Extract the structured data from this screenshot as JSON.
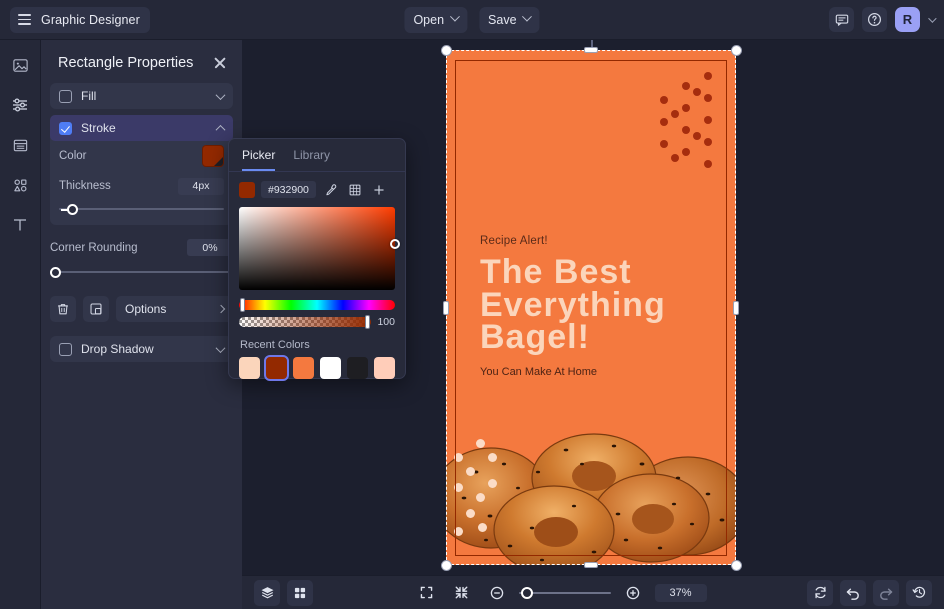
{
  "topbar": {
    "menu_label": "Graphic Designer",
    "menu_icon": "hamburger-icon",
    "open_label": "Open",
    "save_label": "Save",
    "comment_icon": "comment-icon",
    "help_icon": "help-circle-icon",
    "avatar_initial": "R"
  },
  "rail": {
    "items": [
      {
        "name": "image-icon"
      },
      {
        "name": "adjustments-icon"
      },
      {
        "name": "layout-icon"
      },
      {
        "name": "shapes-icon"
      },
      {
        "name": "text-icon"
      }
    ]
  },
  "panel": {
    "title": "Rectangle Properties",
    "close_label": "×",
    "fill": {
      "label": "Fill",
      "checked": false
    },
    "stroke": {
      "label": "Stroke",
      "checked": true
    },
    "color": {
      "label": "Color",
      "value": "#932900"
    },
    "thickness": {
      "label": "Thickness",
      "value": "4px",
      "percent": 5
    },
    "corner_rounding": {
      "label": "Corner Rounding",
      "value": "0%",
      "percent": 0
    },
    "delete_icon": "trash-icon",
    "duplicate_icon": "duplicate-icon",
    "options_label": "Options",
    "drop_shadow": {
      "label": "Drop Shadow",
      "checked": false
    }
  },
  "picker": {
    "tabs": [
      {
        "label": "Picker",
        "active": true
      },
      {
        "label": "Library",
        "active": false
      }
    ],
    "hex": "#932900",
    "eyedropper_icon": "eyedropper-icon",
    "palette_icon": "grid-palette-icon",
    "add_icon": "plus-icon",
    "alpha_value": "100",
    "recent_title": "Recent Colors",
    "recent_colors": [
      {
        "hex": "#fbd5bb",
        "selected": false
      },
      {
        "hex": "#932900",
        "selected": true
      },
      {
        "hex": "#f4793f",
        "selected": false
      },
      {
        "hex": "#ffffff",
        "selected": false
      },
      {
        "hex": "#1e1e22",
        "selected": false
      },
      {
        "hex": "#ffcdb9",
        "selected": false
      }
    ]
  },
  "canvas": {
    "background": "#f4793f",
    "stroke_color": "#932900",
    "eyebrow": "Recipe Alert!",
    "headline": "The Best Everything Bagel!",
    "subcopy": "You Can Make At Home",
    "headline_color": "#fbd5bb",
    "dot_color": "#a62d0e"
  },
  "bottombar": {
    "layers_icon": "layers-icon",
    "grid_icon": "grid-view-icon",
    "fit_icon": "fit-screen-icon",
    "collapse_icon": "collapse-arrows-icon",
    "zoom_out_icon": "zoom-out-icon",
    "zoom_in_icon": "zoom-in-icon",
    "zoom_value": "37%",
    "zoom_percent": 37,
    "sync_icon": "refresh-icon",
    "undo_icon": "undo-icon",
    "redo_icon": "redo-icon",
    "history_icon": "history-icon"
  }
}
